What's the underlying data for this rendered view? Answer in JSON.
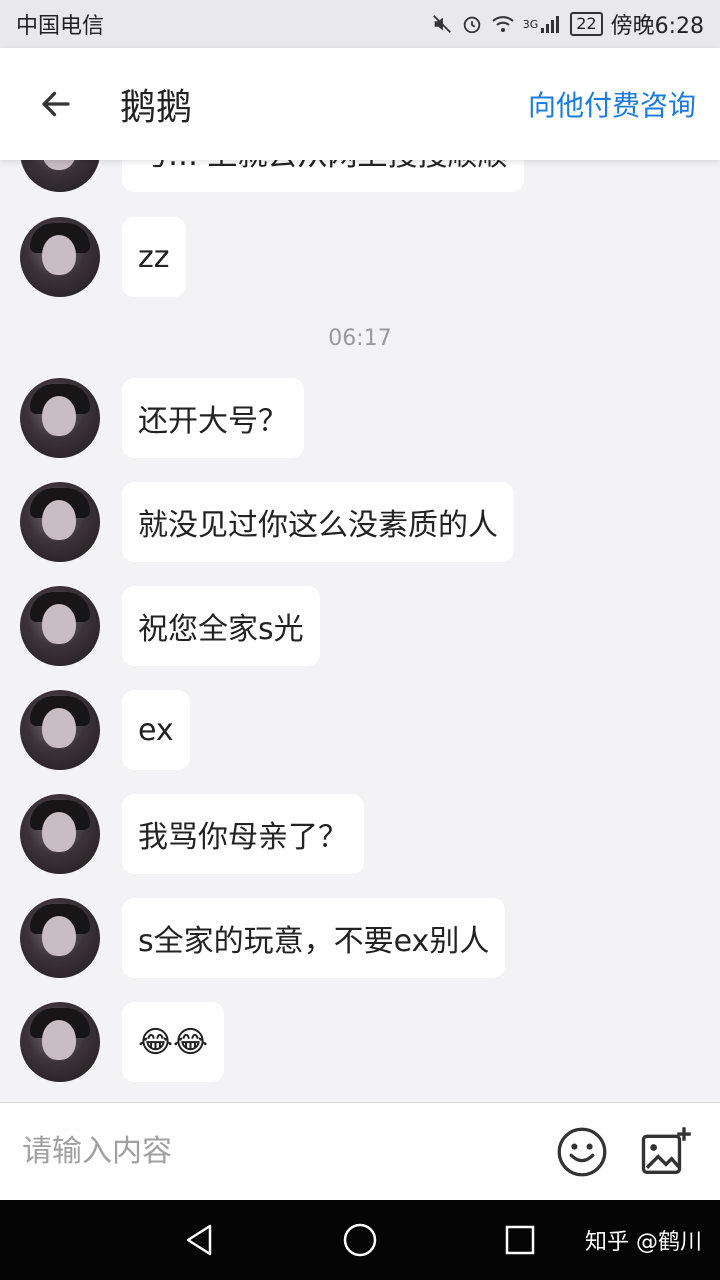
{
  "status_bar": {
    "carrier": "中国电信",
    "network": "3G",
    "battery": "22",
    "time": "傍晚6:28"
  },
  "header": {
    "title": "鹅鹅",
    "pay_link": "向他付费咨询"
  },
  "chat": {
    "timestamp": "06:17",
    "messages": [
      {
        "text": "与… 上就去从网上搜搜顺顺"
      },
      {
        "text": "zz"
      },
      {
        "text": "还开大号？"
      },
      {
        "text": "就没见过你这么没素质的人"
      },
      {
        "text": "祝您全家s光"
      },
      {
        "text": "ex"
      },
      {
        "text": "我骂你母亲了？"
      },
      {
        "text": "s全家的玩意，不要ex别人"
      },
      {
        "text": "😂😂"
      }
    ]
  },
  "input": {
    "placeholder": "请输入内容",
    "emoji_icon": "smiley-icon",
    "image_icon": "add-image-icon"
  },
  "watermark": "知乎 @鹤川",
  "colors": {
    "accent": "#1a7be0",
    "bubble": "#ffffff",
    "background": "#f3f3f5"
  }
}
